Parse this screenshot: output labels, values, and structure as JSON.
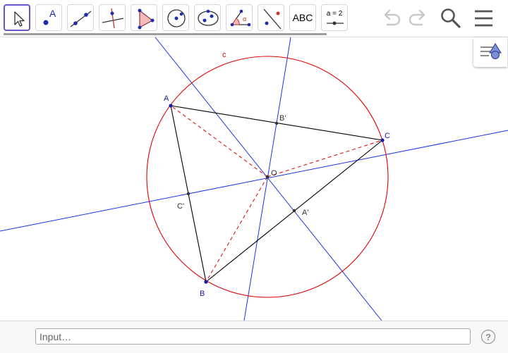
{
  "toolbar": {
    "tools": [
      {
        "name": "move-tool",
        "icon": "arrow-cursor-icon",
        "selected": true
      },
      {
        "name": "point-tool",
        "icon": "point-icon",
        "label": "A"
      },
      {
        "name": "line-tool",
        "icon": "line-through-two-points-icon"
      },
      {
        "name": "perpendicular-line-tool",
        "icon": "perpendicular-line-icon"
      },
      {
        "name": "polygon-tool",
        "icon": "polygon-icon"
      },
      {
        "name": "circle-center-point-tool",
        "icon": "circle-with-center-icon"
      },
      {
        "name": "ellipse-tool",
        "icon": "ellipse-icon"
      },
      {
        "name": "angle-tool",
        "icon": "angle-icon",
        "label": "α"
      },
      {
        "name": "reflect-tool",
        "icon": "reflect-about-line-icon"
      },
      {
        "name": "text-tool",
        "icon": "text-icon",
        "label": "ABC"
      },
      {
        "name": "slider-tool",
        "icon": "slider-icon",
        "label": "a = 2"
      }
    ],
    "undo_icon": "undo-icon",
    "redo_icon": "redo-icon",
    "search_icon": "search-icon",
    "menu_icon": "hamburger-menu-icon"
  },
  "algebra_toggle": {
    "icon": "algebra-view-icon"
  },
  "construction": {
    "circle_label": "c",
    "points": {
      "A": "A",
      "B": "B",
      "C": "C",
      "O": "O",
      "A_mid": "A'",
      "B_mid": "B'",
      "C_mid": "C'"
    },
    "colors": {
      "triangle": "#000000",
      "circle": "#e00000",
      "bisectors": "#1a35e6",
      "radii": "#e00000",
      "vertex_labels": "#1a1aa8"
    }
  },
  "input_bar": {
    "placeholder": "Input…",
    "value": "",
    "help_icon": "help-icon",
    "help_label": "?"
  }
}
